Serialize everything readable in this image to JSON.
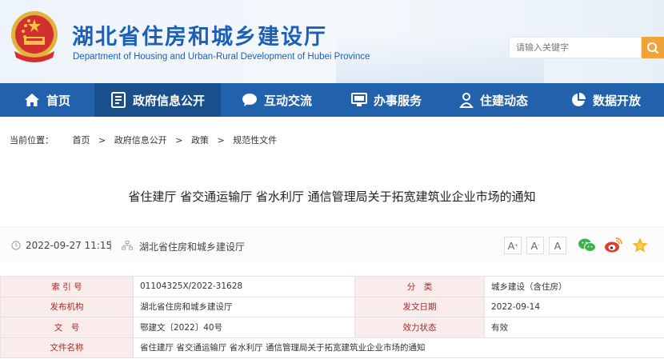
{
  "header": {
    "title": "湖北省住房和城乡建设厅",
    "subtitle": "Department of Housing and Urban-Rural Development of Hubei Province",
    "search_placeholder": "请输入关键字",
    "emblem_icon": "national-emblem-icon",
    "search_icon": "search-icon"
  },
  "nav": {
    "items": [
      {
        "label": "首页",
        "icon": "home-icon"
      },
      {
        "label": "政府信息公开",
        "icon": "document-list-icon",
        "active": true
      },
      {
        "label": "互动交流",
        "icon": "chat-bubble-icon"
      },
      {
        "label": "办事服务",
        "icon": "monitor-icon"
      },
      {
        "label": "住建动态",
        "icon": "person-icon"
      },
      {
        "label": "数据开放",
        "icon": "pie-chart-icon"
      }
    ]
  },
  "breadcrumb": {
    "prefix": "当前位置：",
    "items": [
      "首页",
      "政府信息公开",
      "政策",
      "规范性文件"
    ],
    "separator": ">"
  },
  "article": {
    "title": "省住建厅 省交通运输厅 省水利厅 通信管理局关于拓宽建筑业企业市场的通知",
    "date": "2022-09-27 11:15",
    "divider": "|",
    "source": "湖北省住房和城乡建设厅"
  },
  "font_controls": [
    "A",
    "A",
    "A"
  ],
  "share": [
    "wechat-icon",
    "weibo-icon",
    "favorite-star-icon"
  ],
  "meta": {
    "rows": [
      {
        "label1": "索 引 号",
        "value1": "01104325X/2022-31628",
        "label2": "分　类",
        "value2": "城乡建设（含住房）"
      },
      {
        "label1": "发布机构",
        "value1": "湖北省住房和城乡建设厅",
        "label2": "发文日期",
        "value2": "2022-09-14"
      },
      {
        "label1": "文　号",
        "value1": "鄂建文〔2022〕40号",
        "label2": "效力状态",
        "value2": "有效"
      },
      {
        "label1": "文件名称",
        "value1": "省住建厅 省交通运输厅 省水利厅 通信管理局关于拓宽建筑业企业市场的通知"
      }
    ]
  },
  "colors": {
    "brand_blue": "#1c5fb6",
    "nav_blue": "#2261ab",
    "nav_active": "#1a4f8e",
    "search_orange": "#f0a33a",
    "label_red": "#a32a2a",
    "label_bg": "#fbecec"
  }
}
